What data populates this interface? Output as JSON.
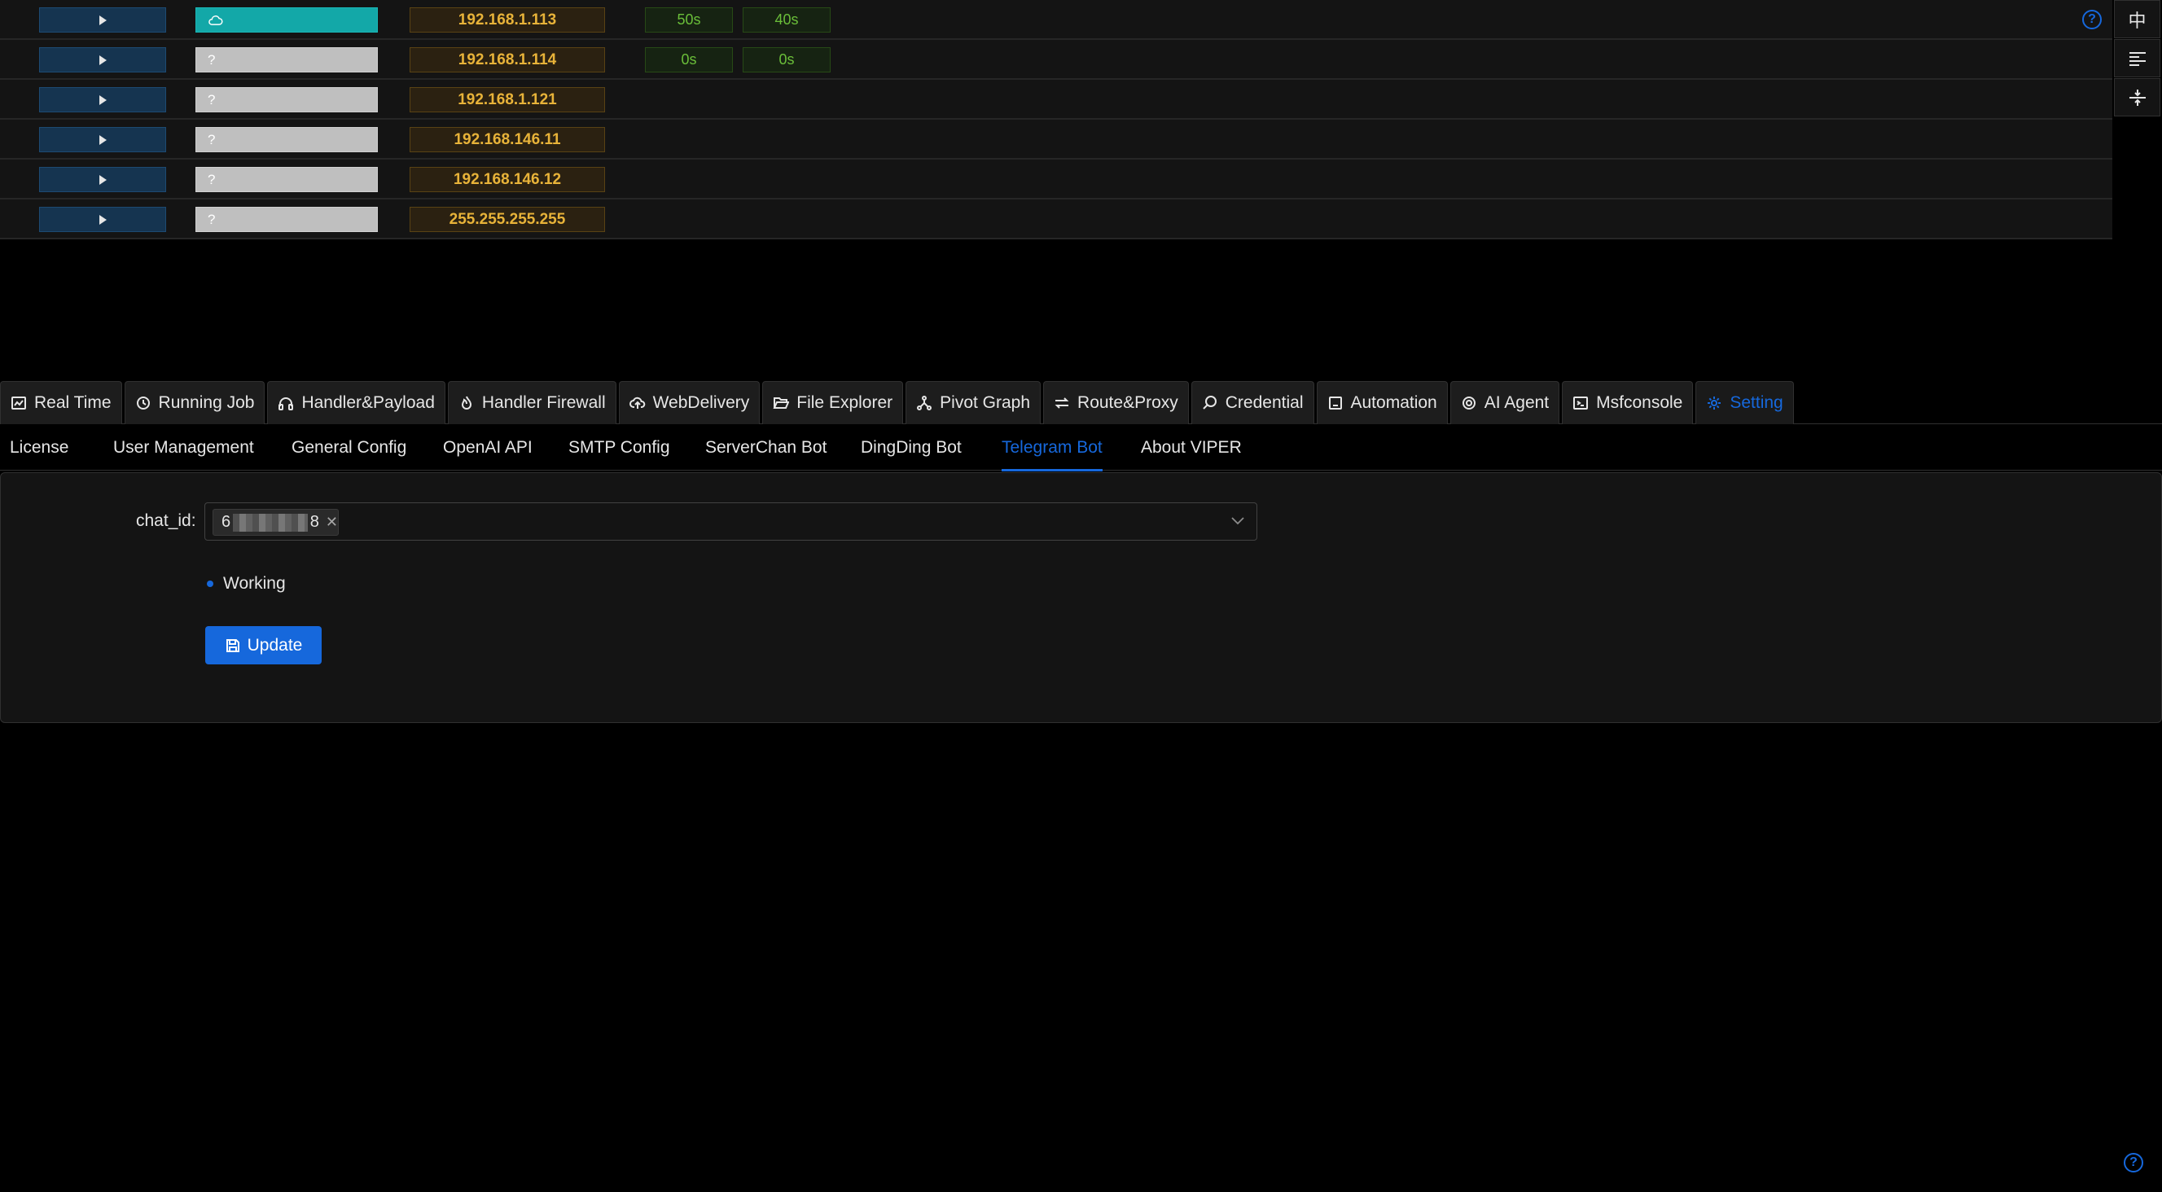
{
  "hosts": [
    {
      "status": "online",
      "status_icon": "cloud-icon",
      "ip": "192.168.1.113",
      "time1": "50s",
      "time2": "40s"
    },
    {
      "status": "unknown",
      "status_text": "?",
      "ip": "192.168.1.114",
      "time1": "0s",
      "time2": "0s"
    },
    {
      "status": "unknown",
      "status_text": "?",
      "ip": "192.168.1.121"
    },
    {
      "status": "unknown",
      "status_text": "?",
      "ip": "192.168.146.11"
    },
    {
      "status": "unknown",
      "status_text": "?",
      "ip": "192.168.146.12"
    },
    {
      "status": "unknown",
      "status_text": "?",
      "ip": "255.255.255.255"
    }
  ],
  "side_tools": {
    "language_label": "中",
    "help_symbol": "?"
  },
  "main_tabs": [
    {
      "label": "Real Time",
      "icon": "chart-icon"
    },
    {
      "label": "Running Job",
      "icon": "history-icon"
    },
    {
      "label": "Handler&Payload",
      "icon": "headphones-icon"
    },
    {
      "label": "Handler Firewall",
      "icon": "fire-icon"
    },
    {
      "label": "WebDelivery",
      "icon": "cloud-upload-icon"
    },
    {
      "label": "File Explorer",
      "icon": "folder-open-icon"
    },
    {
      "label": "Pivot Graph",
      "icon": "network-icon"
    },
    {
      "label": "Route&Proxy",
      "icon": "route-icon"
    },
    {
      "label": "Credential",
      "icon": "search-icon"
    },
    {
      "label": "Automation",
      "icon": "robot-icon"
    },
    {
      "label": "AI Agent",
      "icon": "openai-icon"
    },
    {
      "label": "Msfconsole",
      "icon": "terminal-icon"
    },
    {
      "label": "Setting",
      "icon": "gear-icon",
      "active": true
    }
  ],
  "sub_tabs": [
    {
      "label": "License"
    },
    {
      "label": "User Management"
    },
    {
      "label": "General Config"
    },
    {
      "label": "OpenAI API"
    },
    {
      "label": "SMTP Config"
    },
    {
      "label": "ServerChan Bot"
    },
    {
      "label": "DingDing Bot"
    },
    {
      "label": "Telegram Bot",
      "active": true
    },
    {
      "label": "About VIPER"
    }
  ],
  "telegram": {
    "chat_id_label": "chat_id",
    "chat_id_first": "6",
    "chat_id_last": "8",
    "status": "Working",
    "update_label": "Update"
  },
  "colors": {
    "accent": "#1668dc",
    "online": "#13a8a8",
    "ip_text": "#e8b339",
    "time_text": "#6abe39"
  }
}
